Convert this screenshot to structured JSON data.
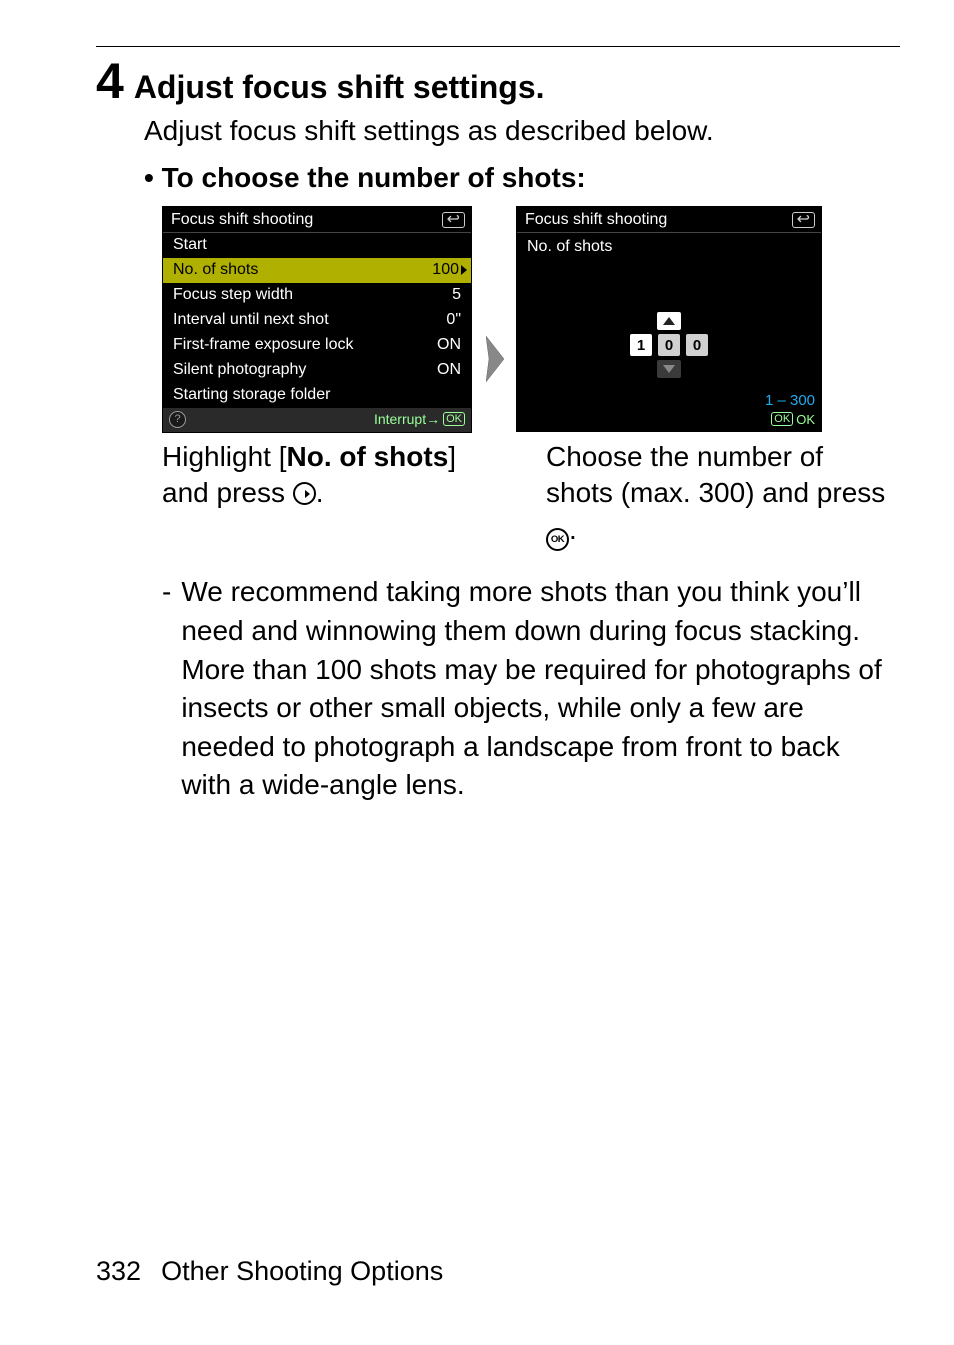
{
  "step": {
    "number": "4",
    "title": "Adjust focus shift settings.",
    "body": "Adjust focus shift settings as described below.",
    "bullet": "• To choose the number of shots:"
  },
  "lcd1": {
    "title": "Focus shift shooting",
    "rows": {
      "start": "Start",
      "noShots": "No. of shots",
      "noShotsVal": "100",
      "stepWidth": "Focus step width",
      "stepWidthVal": "5",
      "interval": "Interval until next shot",
      "intervalVal": "0\"",
      "expLock": "First-frame exposure lock",
      "expLockVal": "ON",
      "silent": "Silent photography",
      "silentVal": "ON",
      "folder": "Starting storage folder"
    },
    "footer": "Interrupt→",
    "footerOk": "OK"
  },
  "lcd2": {
    "title": "Focus shift shooting",
    "subtitle": "No. of shots",
    "d1": "1",
    "d2": "0",
    "d3": "0",
    "range": "1 – 300",
    "ok": "OK",
    "okTxt": "OK"
  },
  "captions": {
    "left_a": "Highlight [",
    "left_b": "No. of shots",
    "left_c": "] and press ",
    "left_d": ".",
    "right_a": "Choose the number of shots (max. 300) and press ",
    "right_b": "."
  },
  "para": "We recommend taking more shots than you think you’ll need and winnowing them down during focus stacking. More than 100 shots may be required for photographs of insects or other small objects, while only a few are needed to photograph a landscape from front to back with a wide-angle lens.",
  "footer": {
    "page": "332",
    "section": "Other Shooting Options"
  }
}
